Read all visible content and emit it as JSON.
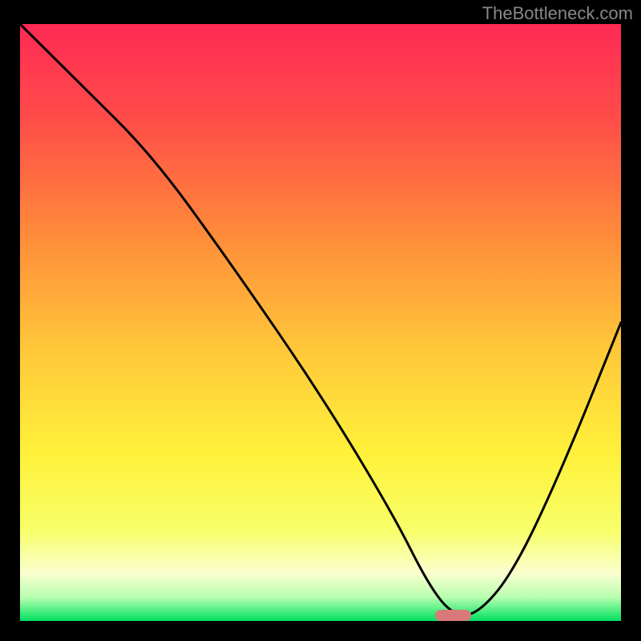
{
  "watermark": "TheBottleneck.com",
  "chart_data": {
    "type": "line",
    "title": "",
    "xlabel": "",
    "ylabel": "",
    "xlim": [
      0,
      100
    ],
    "ylim": [
      0,
      100
    ],
    "grid": false,
    "background": "gradient-red-yellow-green",
    "series": [
      {
        "name": "bottleneck-curve",
        "x": [
          0,
          10,
          22,
          35,
          50,
          62,
          68,
          72,
          76,
          82,
          90,
          100
        ],
        "y": [
          100,
          90,
          78,
          60,
          38,
          18,
          6,
          1,
          1,
          8,
          25,
          50
        ]
      }
    ],
    "marker": {
      "x_start": 69,
      "x_end": 75,
      "y": 1,
      "color": "#d97a7a"
    },
    "gradient_stops": [
      {
        "pos": 0.0,
        "color": "#ff2a55"
      },
      {
        "pos": 0.15,
        "color": "#ff4a4a"
      },
      {
        "pos": 0.35,
        "color": "#ff8a3a"
      },
      {
        "pos": 0.55,
        "color": "#ffc93a"
      },
      {
        "pos": 0.72,
        "color": "#fff13a"
      },
      {
        "pos": 0.85,
        "color": "#f7ff6a"
      },
      {
        "pos": 0.92,
        "color": "#fbffd0"
      },
      {
        "pos": 0.96,
        "color": "#b8ffb0"
      },
      {
        "pos": 1.0,
        "color": "#00e060"
      }
    ]
  }
}
